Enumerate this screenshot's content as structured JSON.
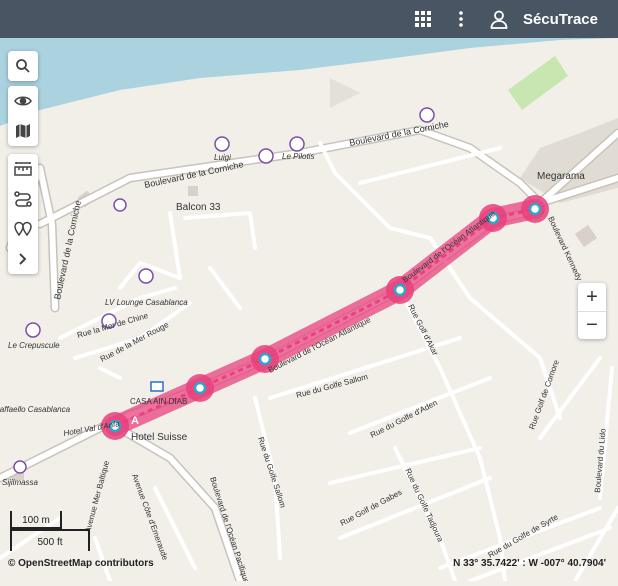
{
  "header": {
    "brand": "SécuTrace",
    "apps_icon": "grid-icon",
    "menu_icon": "kebab-menu-icon",
    "user_icon": "user-icon",
    "background_color": "#4a5564"
  },
  "toolbar_top": [
    {
      "name": "search-icon"
    }
  ],
  "toolbar_view": [
    {
      "name": "eye-icon"
    },
    {
      "name": "map-layers-icon"
    }
  ],
  "toolbar_tools": [
    {
      "name": "ruler-icon"
    },
    {
      "name": "route-icon"
    },
    {
      "name": "waypoints-icon"
    },
    {
      "name": "chevron-right-icon"
    }
  ],
  "zoom": {
    "in": "+",
    "out": "−"
  },
  "map": {
    "labels": {
      "corniche_1": "Boulevard de la Corniche",
      "corniche_2": "Boulevard de la Corniche",
      "corniche_3": "Boulevard de la Corniche",
      "megarama": "Megarama",
      "balcon": "Balcon 33",
      "luigi": "Luigi",
      "pilotis": "Le Pilotis",
      "lv_lounge": "LV Lounge Casablanca",
      "mer_chine": "Rue la Mer de Chine",
      "mer_rouge": "Rue de la Mer Rouge",
      "crepuscule": "Le Crepuscule",
      "ocean_1": "Boulevard de l'Océan Atlantique",
      "ocean_2": "Boulevard de l'Océan Atlantique",
      "golfe_dakar": "Rue Golf d'Akar",
      "golfe_sallom": "Rue du Golfe Sallom",
      "golfe_sallom_2": "Rue du Golfe Sallom",
      "golfe_aden": "Rue du Golfe d'Aden",
      "golfe_gabes": "Rue Golf de Gabes",
      "golfe_tadjoura": "Rue du Golfe Tadjoura",
      "golfe_syrte": "Rue du Golfe de Syrte",
      "comore": "Rue Golf de Comore",
      "lido": "Boulevard du Lido",
      "kennedy": "Boulevard Kennedy",
      "casa_ain_diab": "CASA AIN DIAB",
      "hotel_suisse": "Hotel Suisse",
      "hotel_val": "Hotel Val d'Anfa",
      "raffaello": "Raffaello Casablanca",
      "sijilmassa": "Sijilmassa",
      "mer_baltique": "Avenue Mer Baltique",
      "cote_emeraude": "Avenue Côte d'Emeraude",
      "ocean_pacifique": "Boulevard de l'Océan Pacifique",
      "route_marker": "A"
    },
    "route_color": "#e8417d",
    "water_color": "#aad3df",
    "park_color": "#c8e6b0",
    "waypoint_count": 6
  },
  "scale": {
    "metric": "100 m",
    "imperial": "500 ft"
  },
  "attribution": "© OpenStreetMap contributors",
  "coordinates": "N 33° 35.7422' : W -007° 40.7904'"
}
